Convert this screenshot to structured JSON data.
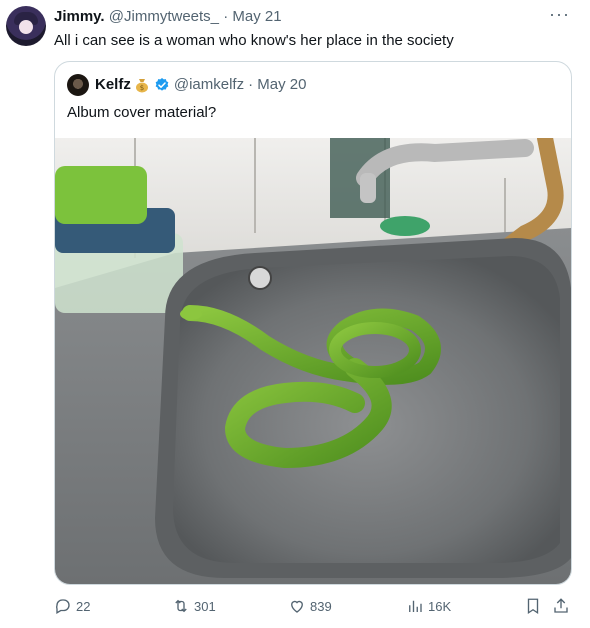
{
  "tweet": {
    "author_name": "Jimmy.",
    "author_handle": "@Jimmytweets_",
    "date": "· May 21",
    "text": "All i can see is a woman who know's her place in the society",
    "more_label": "···"
  },
  "quoted": {
    "author_name": "Kelfz",
    "author_handle": "@iamkelfz",
    "date": "· May 20",
    "text": "Album cover material?",
    "verified_color": "#1d9bf0"
  },
  "actions": {
    "replies": "22",
    "retweets": "301",
    "likes": "839",
    "views": "16K"
  },
  "icons": [
    "reply-icon",
    "retweet-icon",
    "like-icon",
    "views-icon",
    "bookmark-icon",
    "share-icon"
  ]
}
